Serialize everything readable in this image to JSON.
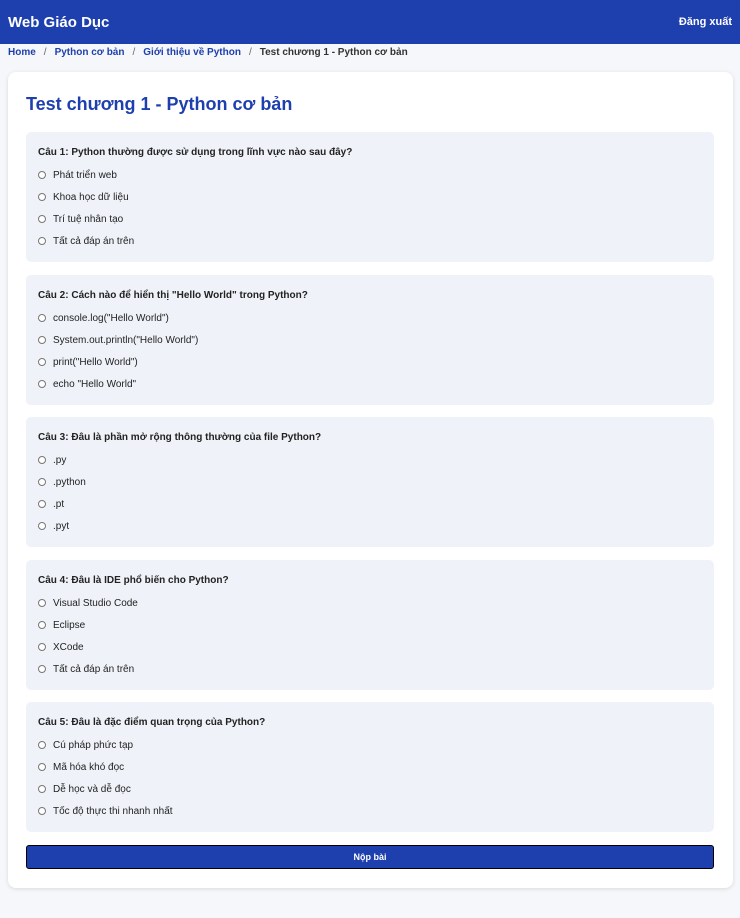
{
  "header": {
    "brand": "Web Giáo Dục",
    "logout_label": "Đăng xuất"
  },
  "breadcrumb": {
    "items": [
      "Home",
      "Python cơ bản",
      "Giới thiệu về Python"
    ],
    "separator": "/",
    "current": "Test chương 1 - Python cơ bản"
  },
  "page": {
    "title": "Test chương 1 - Python cơ bản"
  },
  "questions": [
    {
      "prefix": "Câu 1:",
      "text": "Python thường được sử dụng trong lĩnh vực nào sau đây?",
      "options": [
        "Phát triển web",
        "Khoa học dữ liệu",
        "Trí tuệ nhân tạo",
        "Tất cả đáp án trên"
      ]
    },
    {
      "prefix": "Câu 2:",
      "text": "Cách nào để hiển thị \"Hello World\" trong Python?",
      "options": [
        "console.log(\"Hello World\")",
        "System.out.println(\"Hello World\")",
        "print(\"Hello World\")",
        "echo \"Hello World\""
      ]
    },
    {
      "prefix": "Câu 3:",
      "text": "Đâu là phần mở rộng thông thường của file Python?",
      "options": [
        ".py",
        ".python",
        ".pt",
        ".pyt"
      ]
    },
    {
      "prefix": "Câu 4:",
      "text": "Đâu là IDE phổ biến cho Python?",
      "options": [
        "Visual Studio Code",
        "Eclipse",
        "XCode",
        "Tất cả đáp án trên"
      ]
    },
    {
      "prefix": "Câu 5:",
      "text": "Đâu là đặc điểm quan trọng của Python?",
      "options": [
        "Cú pháp phức tạp",
        "Mã hóa khó đọc",
        "Dễ học và dễ đọc",
        "Tốc độ thực thi nhanh nhất"
      ]
    }
  ],
  "submit_label": "Nộp bài"
}
